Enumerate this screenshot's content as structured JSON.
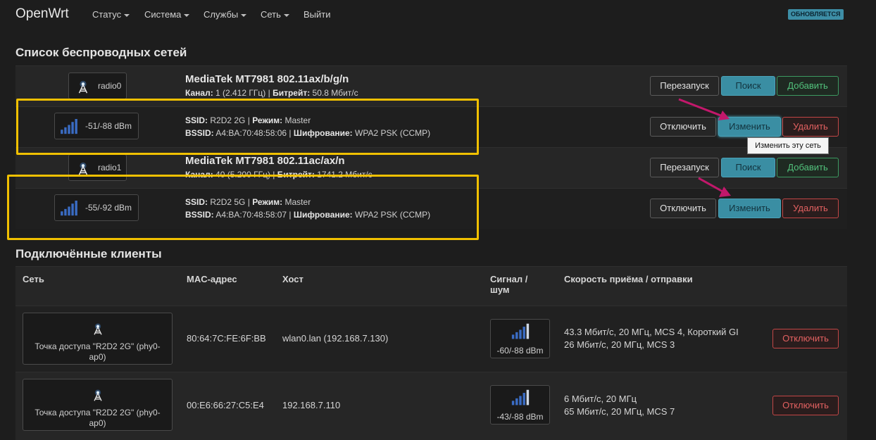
{
  "nav": {
    "brand": "OpenWrt",
    "items": [
      {
        "label": "Статус",
        "has_menu": true
      },
      {
        "label": "Система",
        "has_menu": true
      },
      {
        "label": "Службы",
        "has_menu": true
      },
      {
        "label": "Сеть",
        "has_menu": true
      },
      {
        "label": "Выйти",
        "has_menu": false
      }
    ],
    "badge": "ОБНОВЛЯЕТСЯ",
    "badge_color": "#3d8ea6"
  },
  "wireless": {
    "title": "Список беспроводных сетей",
    "radios": [
      {
        "name": "radio0",
        "icon": "antenna-icon",
        "model": "MediaTek MT7981 802.11ax/b/g/n",
        "channel_label": "Канал:",
        "channel": "1 (2.412 ГГц)",
        "bitrate_label": "Битрейт:",
        "bitrate": "50.8 Мбит/с",
        "buttons": {
          "restart": "Перезапуск",
          "scan": "Поиск",
          "add": "Добавить"
        },
        "network": {
          "signal": "-51/-88 dBm",
          "signal_bars": 5,
          "ssid_label": "SSID:",
          "ssid": "R2D2 2G",
          "mode_label": "Режим:",
          "mode": "Master",
          "bssid_label": "BSSID:",
          "bssid": "A4:BA:70:48:58:06",
          "enc_label": "Шифрование:",
          "encryption": "WPA2 PSK (CCMP)",
          "buttons": {
            "disable": "Отключить",
            "edit": "Изменить",
            "remove": "Удалить"
          }
        }
      },
      {
        "name": "radio1",
        "icon": "antenna-icon",
        "model": "MediaTek MT7981 802.11ac/ax/n",
        "channel_label": "Канал:",
        "channel": "40 (5.200 ГГц)",
        "bitrate_label": "Битрейт:",
        "bitrate": "1741.2 Мбит/с",
        "buttons": {
          "restart": "Перезапуск",
          "scan": "Поиск",
          "add": "Добавить"
        },
        "network": {
          "signal": "-55/-92 dBm",
          "signal_bars": 5,
          "ssid_label": "SSID:",
          "ssid": "R2D2 5G",
          "mode_label": "Режим:",
          "mode": "Master",
          "bssid_label": "BSSID:",
          "bssid": "A4:BA:70:48:58:07",
          "enc_label": "Шифрование:",
          "encryption": "WPA2 PSK (CCMP)",
          "buttons": {
            "disable": "Отключить",
            "edit": "Изменить",
            "remove": "Удалить"
          }
        }
      }
    ],
    "tooltip": "Изменить эту сеть"
  },
  "clients": {
    "title": "Подключённые клиенты",
    "headers": {
      "network": "Сеть",
      "mac": "MAC-адрес",
      "host": "Хост",
      "signal_line1": "Сигнал /",
      "signal_line2": "шум",
      "rate": "Скорость приёма / отправки"
    },
    "rows": [
      {
        "network": "Точка доступа \"R2D2 2G\" (phy0-ap0)",
        "mac": "80:64:7C:FE:6F:BB",
        "host": "wlan0.lan (192.168.7.130)",
        "signal": "-60/-88 dBm",
        "signal_bars": 5,
        "rx": "43.3 Мбит/с, 20 МГц, MCS 4, Короткий GI",
        "tx": "26 Мбит/с, 20 МГц, MCS 3",
        "button": "Отключить"
      },
      {
        "network": "Точка доступа \"R2D2 2G\" (phy0-ap0)",
        "mac": "00:E6:66:27:C5:E4",
        "host": "192.168.7.110",
        "signal": "-43/-88 dBm",
        "signal_bars": 5,
        "rx": "6 Мбит/с, 20 МГц",
        "tx": "65 Мбит/с, 20 МГц, MCS 7",
        "button": "Отключить"
      }
    ]
  },
  "colors": {
    "highlight": "#f0c000",
    "arrow": "#c2186b",
    "primary": "#3a8ea3",
    "danger": "#c34646",
    "positive": "#3c9a61"
  }
}
